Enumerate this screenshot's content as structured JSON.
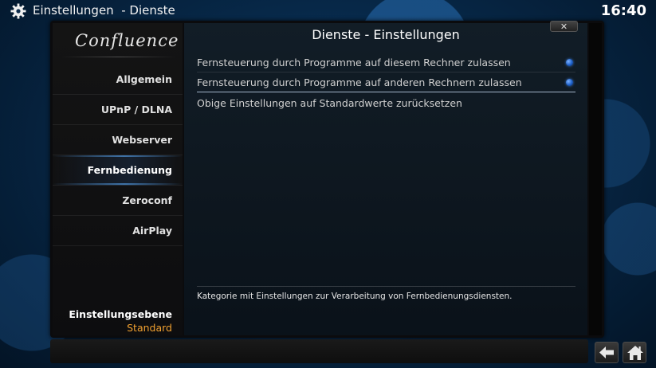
{
  "header": {
    "title": "Einstellungen  - Dienste",
    "time": "16:40"
  },
  "sidebar": {
    "logo": "Confluence",
    "items": [
      {
        "label": "Allgemein",
        "active": false
      },
      {
        "label": "UPnP / DLNA",
        "active": false
      },
      {
        "label": "Webserver",
        "active": false
      },
      {
        "label": "Fernbedienung",
        "active": true
      },
      {
        "label": "Zeroconf",
        "active": false
      },
      {
        "label": "AirPlay",
        "active": false
      }
    ],
    "level_label": "Einstellungsebene",
    "level_value": "Standard"
  },
  "content": {
    "heading": "Dienste - Einstellungen",
    "close_label": "✕",
    "settings": [
      {
        "label": "Fernsteuerung durch Programme auf diesem Rechner zulassen",
        "enabled": true
      },
      {
        "label": "Fernsteuerung durch Programme auf anderen Rechnern zulassen",
        "enabled": true
      },
      {
        "label": "Obige Einstellungen auf Standardwerte zurücksetzen"
      }
    ],
    "description": "Kategorie mit Einstellungen zur Verarbeitung von Fernbedienungsdiensten."
  },
  "footer": {
    "back_icon": "back-arrow-icon",
    "home_icon": "home-icon"
  },
  "colors": {
    "accent": "#f0a030",
    "radio": "#1d5fc8"
  }
}
